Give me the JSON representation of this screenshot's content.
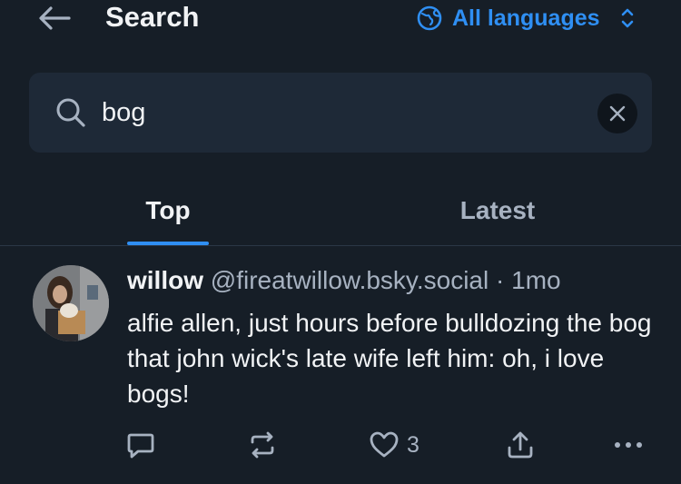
{
  "header": {
    "title": "Search",
    "language_label": "All languages"
  },
  "search": {
    "value": "bog"
  },
  "tabs": [
    {
      "label": "Top",
      "active": true
    },
    {
      "label": "Latest",
      "active": false
    }
  ],
  "post": {
    "display_name": "willow",
    "handle": "@fireatwillow.bsky.social",
    "separator": "·",
    "time": "1mo",
    "text": "alfie allen, just hours before bulldozing the bog that john wick's late wife left him: oh, i love bogs!",
    "like_count": "3"
  },
  "colors": {
    "background": "#161e27",
    "accent": "#2f8ff3",
    "muted": "#a7b2c1"
  }
}
